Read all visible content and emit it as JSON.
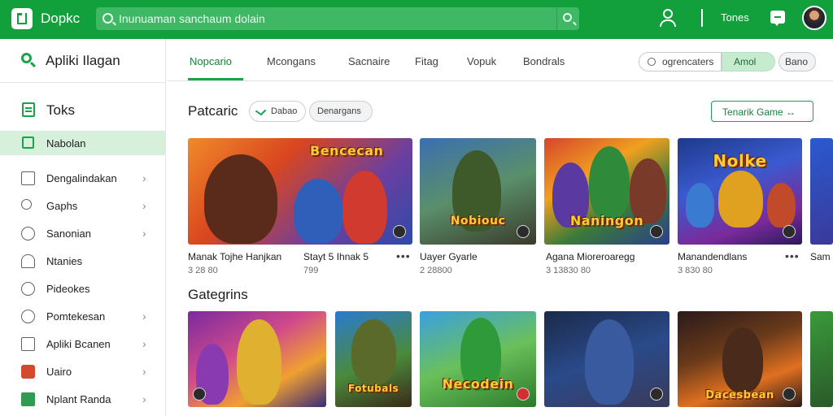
{
  "header": {
    "app_title": "Dopkc",
    "search_placeholder": "Inunuaman sanchaum dolain",
    "label": "Tones"
  },
  "sidebar": {
    "title": "Apliki Ilagan",
    "section": "Toks",
    "selected": "Nabolan",
    "items": [
      {
        "label": "Dengalindakan",
        "chevron": true
      },
      {
        "label": "Gaphs",
        "chevron": true
      },
      {
        "label": "Sanonian",
        "chevron": true
      },
      {
        "label": "Ntanies",
        "chevron": false
      },
      {
        "label": "Pideokes",
        "chevron": false
      },
      {
        "label": "Pomtekesan",
        "chevron": true
      },
      {
        "label": "Apliki Bcanen",
        "chevron": true
      },
      {
        "label": "Uairo",
        "chevron": true
      },
      {
        "label": "Nplant Randa",
        "chevron": true
      }
    ]
  },
  "nav": {
    "tabs": [
      "Nopcario",
      "Mcongans",
      "Sacnaire",
      "Fitag",
      "Vopuk",
      "Bondrals"
    ],
    "active_tab": 0,
    "search_pill": "ogrencaters",
    "green_pill": "Amol",
    "gray_pill": "Bano"
  },
  "featured": {
    "title": "Patcaric",
    "chip1": "Dabao",
    "chip2": "Denargans",
    "see_all": "Tenarik Game ↔",
    "cards": [
      {
        "title": "Manak Tojhe Hanjkan",
        "sub": "3 28 80",
        "logo": "Bencecan",
        "dots": true
      },
      {
        "title": "Stayt 5 Ihnak 5",
        "sub": "799",
        "logo": "",
        "dots": true
      },
      {
        "title": "Uayer Gyarle",
        "sub": "2 28800",
        "logo": "Nobiouc",
        "dots": false
      },
      {
        "title": "Agana Mioreroaregg",
        "sub": "3 13830 80",
        "logo": "Naningon",
        "dots": false
      },
      {
        "title": "Manandendlans",
        "sub": "3 830 80",
        "logo": "Nolke",
        "dots": true
      },
      {
        "title": "Sam",
        "sub": "",
        "logo": "",
        "dots": false
      }
    ]
  },
  "categories": {
    "title": "Gategrins",
    "cards": [
      {
        "logo": ""
      },
      {
        "logo": "Fotubals"
      },
      {
        "logo": "Necodein"
      },
      {
        "logo": ""
      },
      {
        "logo": "Dacesbean"
      },
      {
        "logo": ""
      }
    ]
  },
  "colors": {
    "brand_green": "#12a03c",
    "accent_green": "#1aa34a",
    "selected_bg": "#d7f0dc"
  }
}
